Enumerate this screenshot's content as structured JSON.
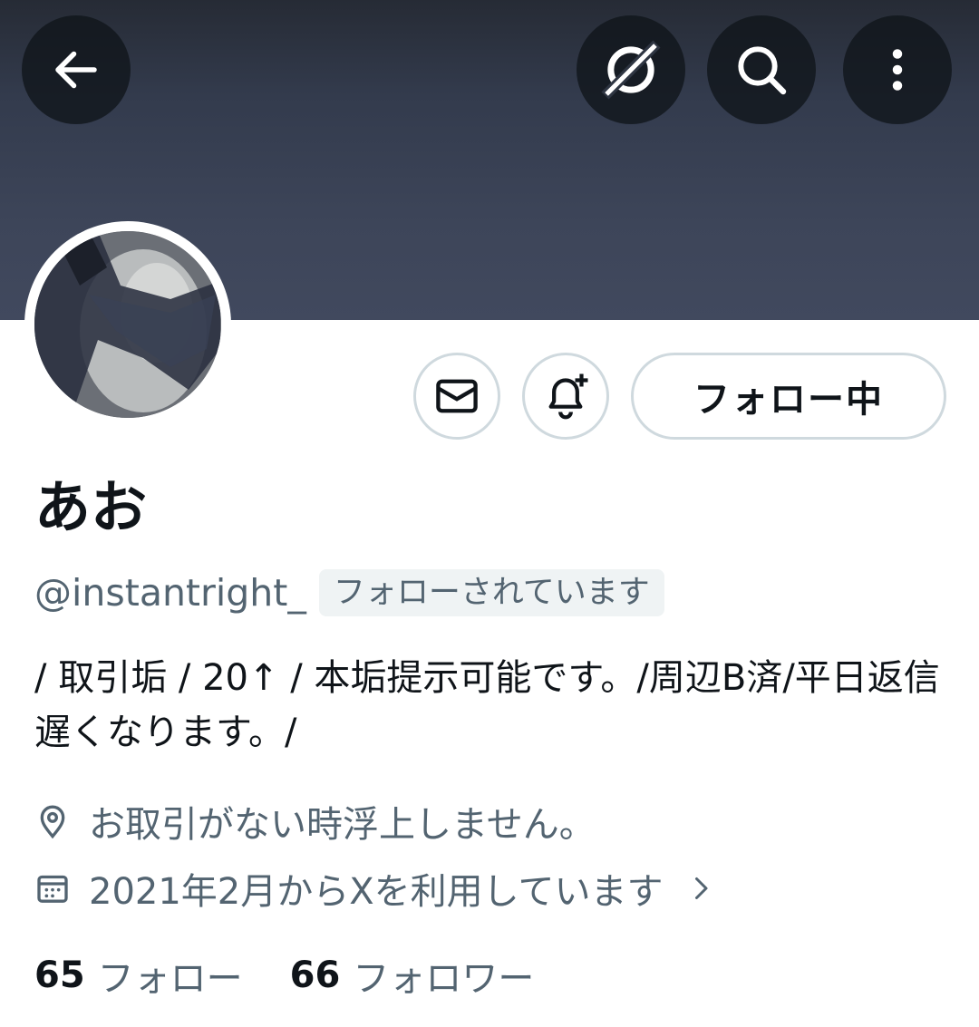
{
  "header": {
    "back_icon": "arrow-left-icon",
    "grok_icon": "grok-icon",
    "search_icon": "search-icon",
    "more_icon": "more-vertical-icon"
  },
  "profile": {
    "display_name": "あお",
    "handle": "@instantright_",
    "follows_you_badge": "フォローされています",
    "bio": "/ 取引垢 / 20↑ / 本垢提示可能です。/周辺B済/平日返信遅くなります。/",
    "location": "お取引がない時浮上しません。",
    "joined": "2021年2月からXを利用しています"
  },
  "actions": {
    "message_icon": "mail-icon",
    "notify_icon": "bell-plus-icon",
    "follow_label": "フォロー中"
  },
  "stats": {
    "following_count": "65",
    "following_label": "フォロー",
    "followers_count": "66",
    "followers_label": "フォロワー"
  },
  "colors": {
    "banner": "#3d4559",
    "text_primary": "#0f1419",
    "text_secondary": "#536471",
    "border": "#cfd9de"
  }
}
